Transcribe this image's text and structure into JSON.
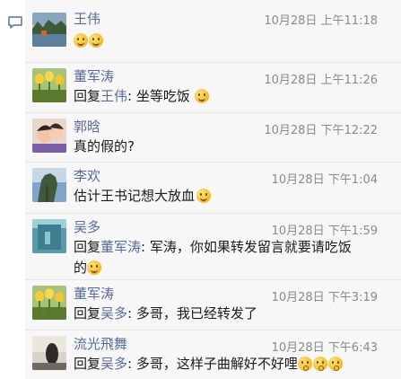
{
  "comments": [
    {
      "name": "王伟",
      "time": "10月28日 上午11:18",
      "text": "",
      "emojis": [
        "smirk-emoji",
        "grin-emoji"
      ]
    },
    {
      "name": "董军涛",
      "time": "10月28日 上午11:26",
      "reply_prefix": "回复",
      "reply_to": "王伟",
      "text": ": 坐等吃饭",
      "emojis": [
        "laugh-emoji"
      ]
    },
    {
      "name": "郭晗",
      "time": "10月28日 下午12:22",
      "text": "真的假的?",
      "emojis": []
    },
    {
      "name": "李欢",
      "time": "10月28日 下午1:04",
      "text": "估计王书记想大放血",
      "emojis": [
        "money-emoji"
      ]
    },
    {
      "name": "吴多",
      "time": "10月28日 下午1:59",
      "reply_prefix": "回复",
      "reply_to": "董军涛",
      "text_line1": ": 军涛，你如果转发留言就要请吃饭",
      "text_line2": "的",
      "emojis": [
        "smirk-emoji"
      ]
    },
    {
      "name": "董军涛",
      "time": "10月28日 下午3:19",
      "reply_prefix": "回复",
      "reply_to": "吴多",
      "text": ": 多哥，我已经转发了",
      "emojis": []
    },
    {
      "name": "流光飛舞",
      "time": "10月28日 下午6:43",
      "reply_prefix": "回复",
      "reply_to": "吴多",
      "text": ": 多哥，这样子曲解好不好哩",
      "emojis": [
        "wow-emoji",
        "wow-emoji",
        "wow-emoji"
      ]
    }
  ],
  "colors": {
    "name": "#576b95",
    "time": "#8a8a8a",
    "panel_bg": "#f7f7f7",
    "divider": "#e6e6e6",
    "icon": "#576b95"
  },
  "icons": {
    "comment": "comment-bubble-icon"
  }
}
